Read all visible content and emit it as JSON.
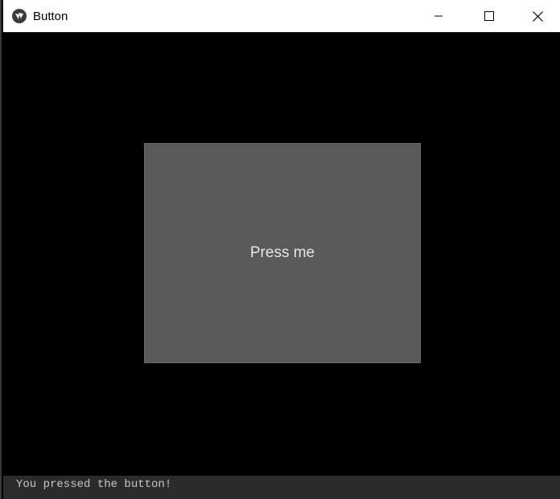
{
  "window": {
    "title": "Button",
    "icon": "kivy-logo-icon"
  },
  "controls": {
    "minimize": "—",
    "maximize": "☐",
    "close": "✕"
  },
  "main": {
    "button_label": "Press me"
  },
  "console": {
    "output": "You pressed the button!"
  }
}
